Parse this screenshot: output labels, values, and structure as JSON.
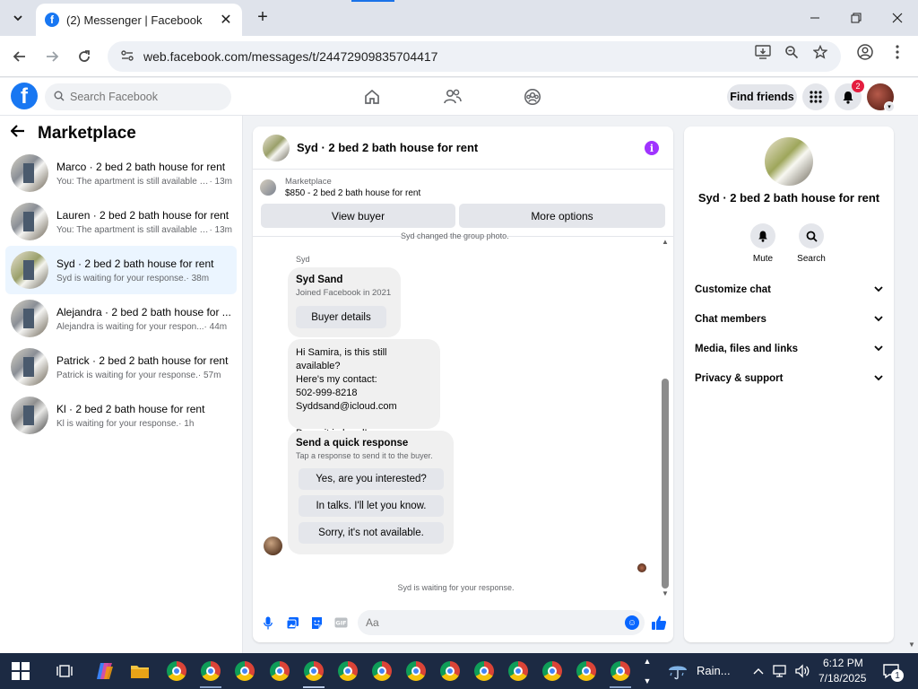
{
  "browser": {
    "tab_title": "(2) Messenger | Facebook",
    "tab_close": "✕",
    "new_tab": "+",
    "url": "web.facebook.com/messages/t/24472909835704417"
  },
  "fb": {
    "logo_letter": "f",
    "search_placeholder": "Search Facebook",
    "find_friends": "Find friends",
    "notification_count": "2"
  },
  "sidebar": {
    "title": "Marketplace",
    "conversations": [
      {
        "name": "Marco · 2 bed 2 bath house for rent",
        "preview": "You: The apartment is still available f...",
        "time": " · 13m"
      },
      {
        "name": "Lauren · 2 bed 2 bath house for rent",
        "preview": "You: The apartment is still available f...",
        "time": " · 13m"
      },
      {
        "name": "Syd · 2 bed 2 bath house for rent",
        "preview": "Syd is waiting for your response.",
        "time": " · 38m"
      },
      {
        "name": "Alejandra · 2 bed 2 bath house for ...",
        "preview": "Alejandra is waiting for your respon...",
        "time": " · 44m"
      },
      {
        "name": "Patrick · 2 bed 2 bath house for rent",
        "preview": "Patrick is waiting for your response.",
        "time": " · 57m"
      },
      {
        "name": "Kl · 2 bed 2 bath house for rent",
        "preview": "Kl is waiting for your response.",
        "time": " · 1h"
      }
    ]
  },
  "chat": {
    "title": "Syd · 2 bed 2 bath house for rent",
    "listing_label": "Marketplace",
    "listing_detail": "$850 - 2 bed 2 bath house for rent",
    "view_buyer": "View buyer",
    "more_options": "More options",
    "system_cut": "Syd changed the group photo.",
    "sender": "Syd",
    "buyer_name": "Syd Sand",
    "buyer_joined": "Joined Facebook in 2021",
    "buyer_details": "Buyer details",
    "message_lines": [
      "Hi Samira, is this still available?",
      "Here's my contact:",
      "502-999-8218",
      "Syddsand@icloud.com",
      "",
      "Deposit in hand!"
    ],
    "quick_title": "Send a quick response",
    "quick_sub": "Tap a response to send it to the buyer.",
    "quick_replies": [
      "Yes, are you interested?",
      "In talks. I'll let you know.",
      "Sorry, it's not available."
    ],
    "waiting": "Syd is waiting for your response.",
    "composer_placeholder": "Aa"
  },
  "details": {
    "title": "Syd · 2 bed 2 bath house for rent",
    "mute": "Mute",
    "search": "Search",
    "sections": [
      "Customize chat",
      "Chat members",
      "Media, files and links",
      "Privacy & support"
    ]
  },
  "taskbar": {
    "weather": "Rain...",
    "time": "6:12 PM",
    "date": "7/18/2025",
    "notifications": "1"
  },
  "colors": {
    "facebook_blue": "#1877f2",
    "messenger_blue": "#0866ff",
    "info_purple": "#a033ff",
    "active_row": "#ebf5ff",
    "badge_red": "#e41e3f"
  }
}
